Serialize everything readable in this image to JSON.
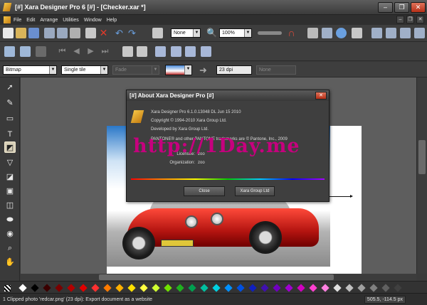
{
  "window": {
    "title": "[#] Xara Designer Pro 6 [#] - [Checker.xar *]"
  },
  "window_buttons": {
    "minimize": "–",
    "restore": "❐",
    "close": "✕"
  },
  "menu": {
    "items": [
      "File",
      "Edit",
      "Arrange",
      "Utilities",
      "Window",
      "Help"
    ]
  },
  "toolbar": {
    "quality_select": "None",
    "zoom_select": "100%"
  },
  "infobar": {
    "bitmap_select": "Bitmap",
    "tile_select": "Single tile",
    "fade_select": "Fade",
    "dpi_field": "23 dpi",
    "none_field": "None"
  },
  "dialog": {
    "title": "[#] About Xara Designer Pro [#]",
    "version": "Xara Designer Pro 6.1.0.13048  DL Jun 15 2010",
    "copyright": "Copyright © 1994-2010 Xara Group Ltd.",
    "developer": "Developed by Xara Group Ltd.",
    "pantone": "PANTONE® and other PANTONE trademarks are © Pantone, Inc., 2009",
    "licensee_label": "Licensee:",
    "licensee_value": "zoo",
    "organization_label": "Organization:",
    "organization_value": "zoo",
    "close_button": "Close",
    "xara_button": "Xara Group Ltd"
  },
  "watermark": "http://1Day.me",
  "status": {
    "text": "1 Clipped photo 'redcar.png' (23 dpi): Export document as a website",
    "coords": "505.5, -114.5 px"
  },
  "palette_colors": [
    "#ffffff",
    "#000000",
    "#3a0000",
    "#7a0000",
    "#b30000",
    "#e00000",
    "#ff3030",
    "#ff7a00",
    "#ffb000",
    "#ffe000",
    "#ffff40",
    "#d0ff30",
    "#70e000",
    "#20b020",
    "#00a050",
    "#00c0a0",
    "#00d0e0",
    "#0090ff",
    "#0050e0",
    "#1020c0",
    "#4010b0",
    "#7000c0",
    "#a000d0",
    "#d000c0",
    "#ff40d0",
    "#ff80e0",
    "#e0e0e0",
    "#c0c0c0",
    "#a0a0a0",
    "#808080",
    "#606060",
    "#404040"
  ]
}
